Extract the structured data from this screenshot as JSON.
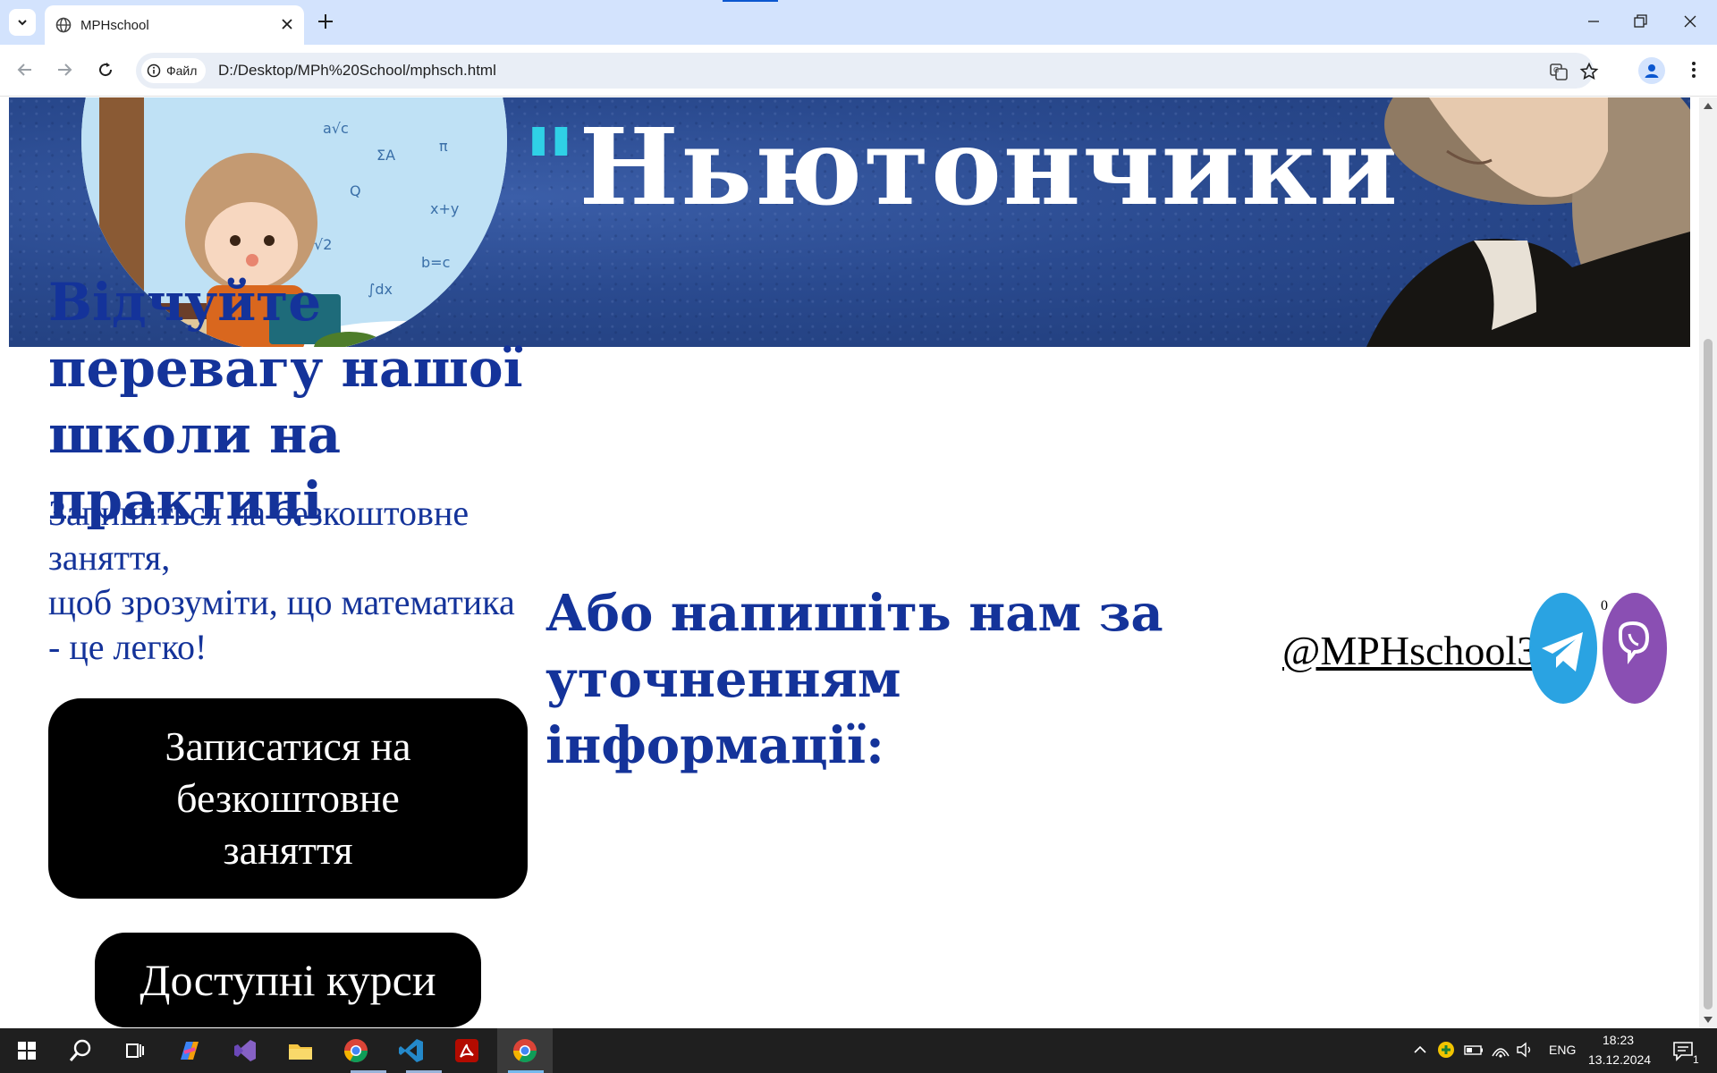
{
  "browser": {
    "tab_title": "MPHschool",
    "site_chip_label": "Файл",
    "url": "D:/Desktop/MPh%20School/mphsch.html",
    "new_tab_symbol": "+",
    "close_tab_symbol": "✕"
  },
  "page": {
    "banner": {
      "quote_open": "\"",
      "title_word": "Ньютончики",
      "quote_close": "\"",
      "quote_color": "#2fd1e6",
      "background_color": "#2a4a8f"
    },
    "hero": {
      "heading": "Відчуйте перевагу нашої школи на практиці",
      "sub_line1": "Запишіться на безкоштовне заняття,",
      "sub_line2": "щоб зрозуміти, що математика - це легко!",
      "signup_button": "Записатися на безкоштовне заняття",
      "courses_button": "Доступні курси"
    },
    "contact": {
      "heading": "Або напишіть нам за уточненням інформації:",
      "handle": "@MPHschool3",
      "telegram_icon": "telegram-icon",
      "viber_icon": "viber-icon",
      "stray_char_1": "0",
      "stray_char_2": "1"
    },
    "accent_color": "#14339a"
  },
  "taskbar": {
    "language": "ENG",
    "time": "18:23",
    "date": "13.12.2024",
    "notification_count": "1"
  }
}
